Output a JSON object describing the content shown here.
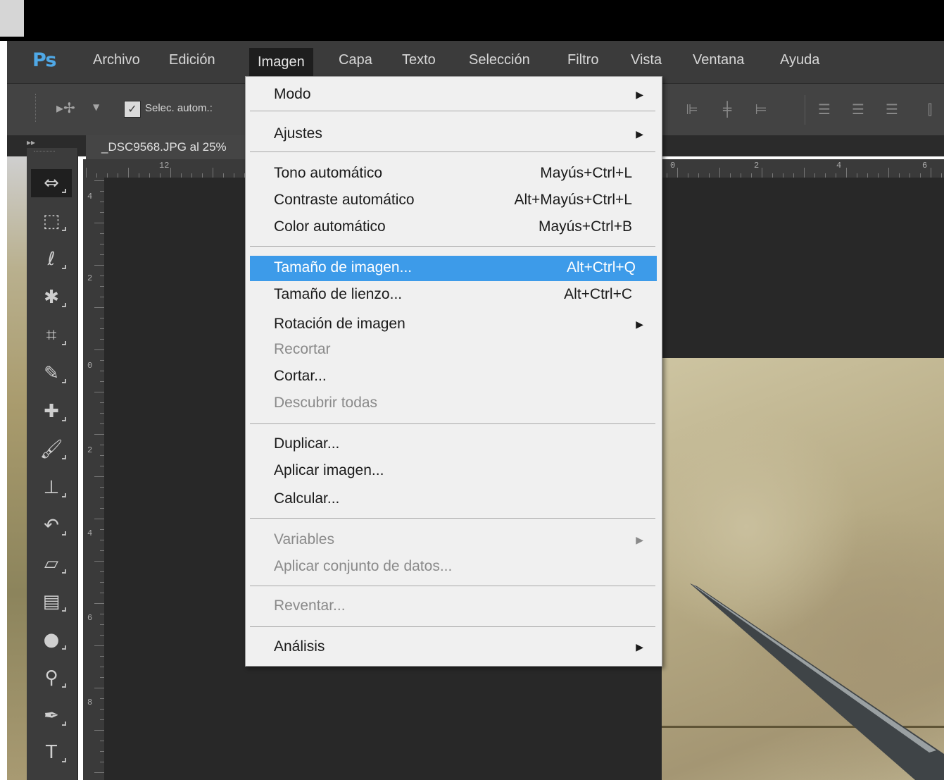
{
  "app": {
    "logo": "Ps"
  },
  "menubar": {
    "items": [
      "Archivo",
      "Edición",
      "Imagen",
      "Capa",
      "Texto",
      "Selección",
      "Filtro",
      "Vista",
      "Ventana",
      "Ayuda"
    ],
    "active": "Imagen"
  },
  "options": {
    "auto_select_label": "Selec. autom.:",
    "auto_select_checked": true,
    "move_tool_icon": "move-tool-icon"
  },
  "document": {
    "tab_title": "_DSC9568.JPG al 25%"
  },
  "rulers": {
    "horizontal_left_label": "12",
    "horizontal_right_labels": [
      "0",
      "2",
      "4",
      "6"
    ],
    "vertical_labels": [
      "4",
      "2",
      "0",
      "2",
      "4",
      "6",
      "8"
    ]
  },
  "toolbar": {
    "tools": [
      {
        "icon": "move-tool-icon",
        "glyph": "⇔"
      },
      {
        "icon": "marquee-tool-icon",
        "glyph": "⬚"
      },
      {
        "icon": "lasso-tool-icon",
        "glyph": "ℓ"
      },
      {
        "icon": "magic-wand-tool-icon",
        "glyph": "✱"
      },
      {
        "icon": "crop-tool-icon",
        "glyph": "⌗"
      },
      {
        "icon": "eyedropper-tool-icon",
        "glyph": "✎"
      },
      {
        "icon": "healing-brush-tool-icon",
        "glyph": "✚"
      },
      {
        "icon": "brush-tool-icon",
        "glyph": "🖌"
      },
      {
        "icon": "stamp-tool-icon",
        "glyph": "⊥"
      },
      {
        "icon": "history-brush-tool-icon",
        "glyph": "↶"
      },
      {
        "icon": "eraser-tool-icon",
        "glyph": "▱"
      },
      {
        "icon": "gradient-tool-icon",
        "glyph": "▤"
      },
      {
        "icon": "blur-tool-icon",
        "glyph": "●"
      },
      {
        "icon": "dodge-tool-icon",
        "glyph": "⚲"
      },
      {
        "icon": "pen-tool-icon",
        "glyph": "✒"
      },
      {
        "icon": "type-tool-icon",
        "glyph": "T"
      }
    ]
  },
  "dropdown": {
    "items": [
      {
        "label": "Modo",
        "shortcut": "",
        "submenu": true,
        "enabled": true
      },
      {
        "label": "Ajustes",
        "shortcut": "",
        "submenu": true,
        "enabled": true
      },
      {
        "label": "Tono automático",
        "shortcut": "Mayús+Ctrl+L",
        "submenu": false,
        "enabled": true
      },
      {
        "label": "Contraste automático",
        "shortcut": "Alt+Mayús+Ctrl+L",
        "submenu": false,
        "enabled": true
      },
      {
        "label": "Color automático",
        "shortcut": "Mayús+Ctrl+B",
        "submenu": false,
        "enabled": true
      },
      {
        "label": "Tamaño de imagen...",
        "shortcut": "Alt+Ctrl+Q",
        "submenu": false,
        "enabled": true,
        "highlighted": true
      },
      {
        "label": "Tamaño de lienzo...",
        "shortcut": "Alt+Ctrl+C",
        "submenu": false,
        "enabled": true
      },
      {
        "label": "Rotación de imagen",
        "shortcut": "",
        "submenu": true,
        "enabled": true
      },
      {
        "label": "Recortar",
        "shortcut": "",
        "submenu": false,
        "enabled": false
      },
      {
        "label": "Cortar...",
        "shortcut": "",
        "submenu": false,
        "enabled": true
      },
      {
        "label": "Descubrir todas",
        "shortcut": "",
        "submenu": false,
        "enabled": false
      },
      {
        "label": "Duplicar...",
        "shortcut": "",
        "submenu": false,
        "enabled": true
      },
      {
        "label": "Aplicar imagen...",
        "shortcut": "",
        "submenu": false,
        "enabled": true
      },
      {
        "label": "Calcular...",
        "shortcut": "",
        "submenu": false,
        "enabled": true
      },
      {
        "label": "Variables",
        "shortcut": "",
        "submenu": true,
        "enabled": false
      },
      {
        "label": "Aplicar conjunto de datos...",
        "shortcut": "",
        "submenu": false,
        "enabled": false
      },
      {
        "label": "Reventar...",
        "shortcut": "",
        "submenu": false,
        "enabled": false
      },
      {
        "label": "Análisis",
        "shortcut": "",
        "submenu": true,
        "enabled": true
      }
    ]
  },
  "colors": {
    "highlight": "#3d9be9",
    "menubar_bg": "#3b3b3b",
    "canvas_bg": "#282828",
    "logo": "#4fa8e6"
  }
}
